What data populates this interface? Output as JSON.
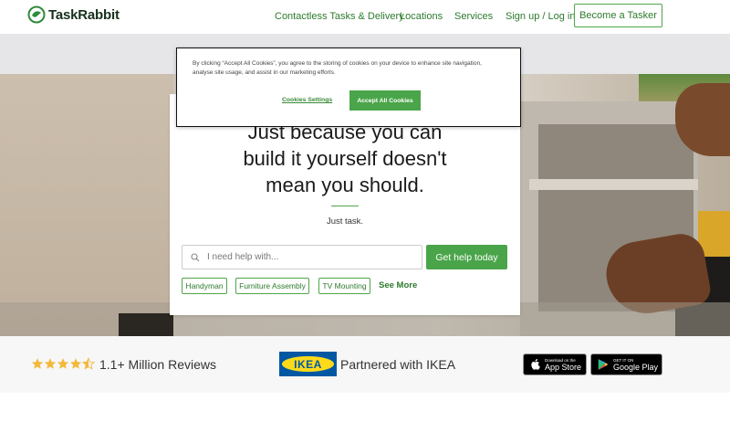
{
  "header": {
    "logo_text": "TaskRabbit",
    "nav": [
      "Contactless Tasks & Delivery",
      "Locations",
      "Services",
      "Sign up / Log in"
    ],
    "cta": "Become a Tasker"
  },
  "hero": {
    "headline_line1": "Just because you can",
    "headline_line2": "build it yourself doesn't",
    "headline_line3": "mean you should.",
    "subline": "Just task.",
    "search_placeholder": "I need help with...",
    "search_button": "Get help today",
    "chips": [
      "Handyman",
      "Furniture Assembly",
      "TV Mounting"
    ],
    "see_more": "See More"
  },
  "cookie_banner": {
    "text": "By clicking “Accept All Cookies”, you agree to the storing of cookies on your device to enhance site navigation, analyse site usage, and assist in our marketing efforts.",
    "settings_label": "Cookies Settings",
    "accept_label": "Accept All Cookies"
  },
  "trust_bar": {
    "rating_stars": 4.5,
    "reviews_text": "1.1+ Million Reviews",
    "ikea_logo_text": "IKEA",
    "partner_text": "Partnered with IKEA",
    "app_store_small": "Download on the",
    "app_store_big": "App Store",
    "google_play_small": "GET IT ON",
    "google_play_big": "Google Play"
  },
  "colors": {
    "brand_green": "#4aa54a",
    "link_green": "#2d7a2d",
    "star_gold": "#f4b83b",
    "ikea_blue": "#0058a3",
    "ikea_yellow": "#ffda1a"
  }
}
